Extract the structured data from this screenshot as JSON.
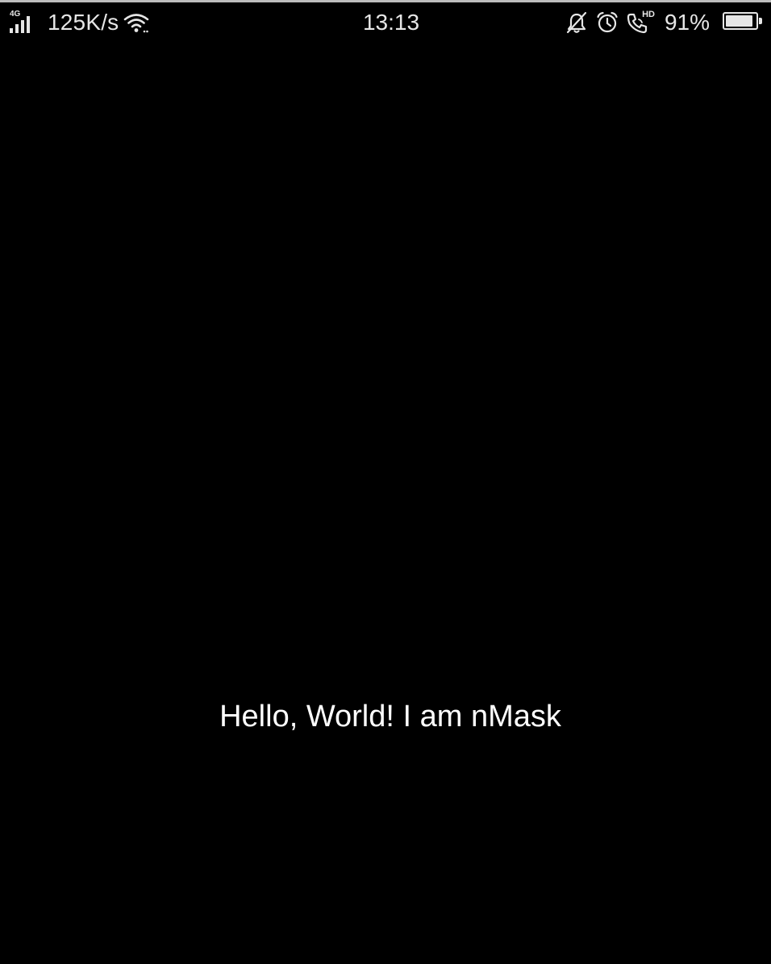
{
  "status_bar": {
    "network_type": "4G",
    "signal_icon": "signal-bars-icon",
    "speed": "125K/s",
    "wifi_icon": "wifi-icon",
    "time": "13:13",
    "mute_icon": "bell-muted-icon",
    "alarm_icon": "alarm-clock-icon",
    "hd_call_icon": "hd-voice-call-icon",
    "hd_label": "HD",
    "battery_percent": "91%",
    "battery_level": 0.91,
    "battery_icon": "battery-icon"
  },
  "main": {
    "greeting": "Hello, World! I am nMask"
  },
  "colors": {
    "background": "#000000",
    "text": "#ffffff",
    "status_text": "#e6e6e6"
  }
}
